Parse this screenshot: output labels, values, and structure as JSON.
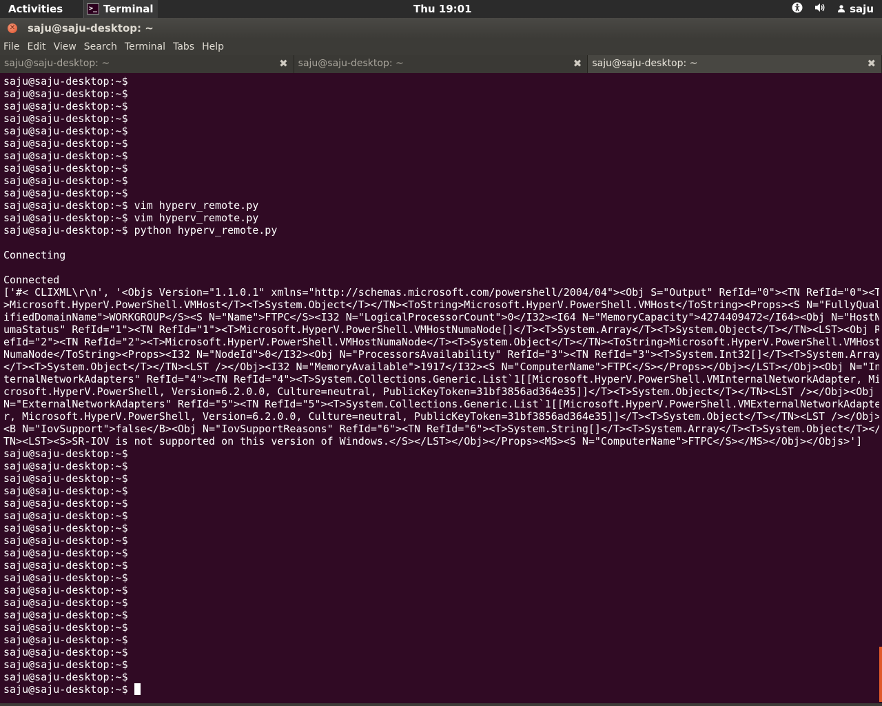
{
  "topbar": {
    "activities": "Activities",
    "app_name": "Terminal",
    "clock": "Thu 19:01",
    "user": "saju"
  },
  "window": {
    "title": "saju@saju-desktop: ~"
  },
  "menu": [
    "File",
    "Edit",
    "View",
    "Search",
    "Terminal",
    "Tabs",
    "Help"
  ],
  "tabs": [
    {
      "label": "saju@saju-desktop: ~",
      "active": false
    },
    {
      "label": "saju@saju-desktop: ~",
      "active": false
    },
    {
      "label": "saju@saju-desktop: ~",
      "active": true
    }
  ],
  "terminal": {
    "lines": [
      "saju@saju-desktop:~$",
      "saju@saju-desktop:~$",
      "saju@saju-desktop:~$",
      "saju@saju-desktop:~$",
      "saju@saju-desktop:~$",
      "saju@saju-desktop:~$",
      "saju@saju-desktop:~$",
      "saju@saju-desktop:~$",
      "saju@saju-desktop:~$",
      "saju@saju-desktop:~$",
      "saju@saju-desktop:~$ vim hyperv_remote.py",
      "saju@saju-desktop:~$ vim hyperv_remote.py",
      "saju@saju-desktop:~$ python hyperv_remote.py",
      "",
      "Connecting",
      "",
      "Connected",
      "['#< CLIXML\\r\\n', '<Objs Version=\"1.1.0.1\" xmlns=\"http://schemas.microsoft.com/powershell/2004/04\"><Obj S=\"Output\" RefId=\"0\"><TN RefId=\"0\"><T",
      ">Microsoft.HyperV.PowerShell.VMHost</T><T>System.Object</T></TN><ToString>Microsoft.HyperV.PowerShell.VMHost</ToString><Props><S N=\"FullyQual",
      "ifiedDomainName\">WORKGROUP</S><S N=\"Name\">FTPC</S><I32 N=\"LogicalProcessorCount\">0</I32><I64 N=\"MemoryCapacity\">4274409472</I64><Obj N=\"HostN",
      "umaStatus\" RefId=\"1\"><TN RefId=\"1\"><T>Microsoft.HyperV.PowerShell.VMHostNumaNode[]</T><T>System.Array</T><T>System.Object</T></TN><LST><Obj R",
      "efId=\"2\"><TN RefId=\"2\"><T>Microsoft.HyperV.PowerShell.VMHostNumaNode</T><T>System.Object</T></TN><ToString>Microsoft.HyperV.PowerShell.VMHost",
      "NumaNode</ToString><Props><I32 N=\"NodeId\">0</I32><Obj N=\"ProcessorsAvailability\" RefId=\"3\"><TN RefId=\"3\"><T>System.Int32[]</T><T>System.Array",
      "</T><T>System.Object</T></TN><LST /></Obj><I32 N=\"MemoryAvailable\">1917</I32><S N=\"ComputerName\">FTPC</S></Props></Obj></LST></Obj><Obj N=\"In",
      "ternalNetworkAdapters\" RefId=\"4\"><TN RefId=\"4\"><T>System.Collections.Generic.List`1[[Microsoft.HyperV.PowerShell.VMInternalNetworkAdapter, Mi",
      "crosoft.HyperV.PowerShell, Version=6.2.0.0, Culture=neutral, PublicKeyToken=31bf3856ad364e35]]</T><T>System.Object</T></TN><LST /></Obj><Obj",
      "N=\"ExternalNetworkAdapters\" RefId=\"5\"><TN RefId=\"5\"><T>System.Collections.Generic.List`1[[Microsoft.HyperV.PowerShell.VMExternalNetworkAdapte",
      "r, Microsoft.HyperV.PowerShell, Version=6.2.0.0, Culture=neutral, PublicKeyToken=31bf3856ad364e35]]</T><T>System.Object</T></TN><LST /></Obj>",
      "<B N=\"IovSupport\">false</B><Obj N=\"IovSupportReasons\" RefId=\"6\"><TN RefId=\"6\"><T>System.String[]</T><T>System.Array</T><T>System.Object</T></",
      "TN><LST><S>SR-IOV is not supported on this version of Windows.</S></LST></Obj></Props><MS><S N=\"ComputerName\">FTPC</S></MS></Obj></Objs>']",
      "saju@saju-desktop:~$",
      "saju@saju-desktop:~$",
      "saju@saju-desktop:~$",
      "saju@saju-desktop:~$",
      "saju@saju-desktop:~$",
      "saju@saju-desktop:~$",
      "saju@saju-desktop:~$",
      "saju@saju-desktop:~$",
      "saju@saju-desktop:~$",
      "saju@saju-desktop:~$",
      "saju@saju-desktop:~$",
      "saju@saju-desktop:~$",
      "saju@saju-desktop:~$",
      "saju@saju-desktop:~$",
      "saju@saju-desktop:~$",
      "saju@saju-desktop:~$",
      "saju@saju-desktop:~$",
      "saju@saju-desktop:~$",
      "saju@saju-desktop:~$"
    ],
    "prompt": "saju@saju-desktop:~$ "
  },
  "icons": {
    "accessibility": "accessibility-icon",
    "volume": "volume-icon",
    "user": "user-icon"
  },
  "colors": {
    "terminal_bg": "#300a24",
    "accent": "#e05a2a"
  }
}
